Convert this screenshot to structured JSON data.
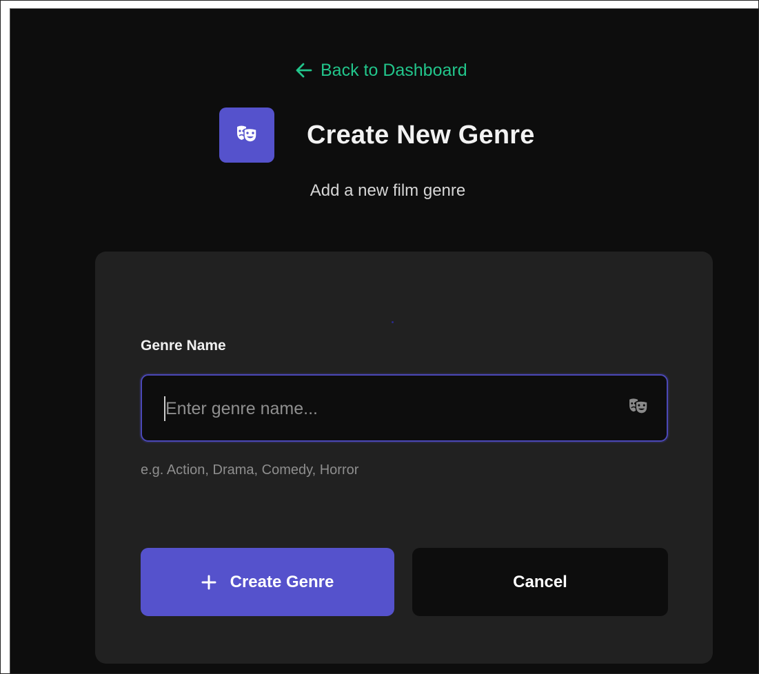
{
  "nav": {
    "back_label": "Back to Dashboard",
    "back_icon": "arrow-left-icon"
  },
  "header": {
    "title": "Create New Genre",
    "subtitle": "Add a new film genre",
    "icon": "theater-masks-icon"
  },
  "form": {
    "genre_name_label": "Genre Name",
    "genre_name_value": "",
    "genre_name_placeholder": "Enter genre name...",
    "genre_name_icon": "theater-masks-icon",
    "genre_name_hint": "e.g. Action, Drama, Comedy, Horror",
    "submit_label": "Create Genre",
    "submit_icon": "plus-icon",
    "cancel_label": "Cancel"
  },
  "colors": {
    "background": "#0d0d0d",
    "card": "#212121",
    "accent": "#5552cc",
    "link": "#22c58b",
    "input_border": "#4b48b8"
  }
}
